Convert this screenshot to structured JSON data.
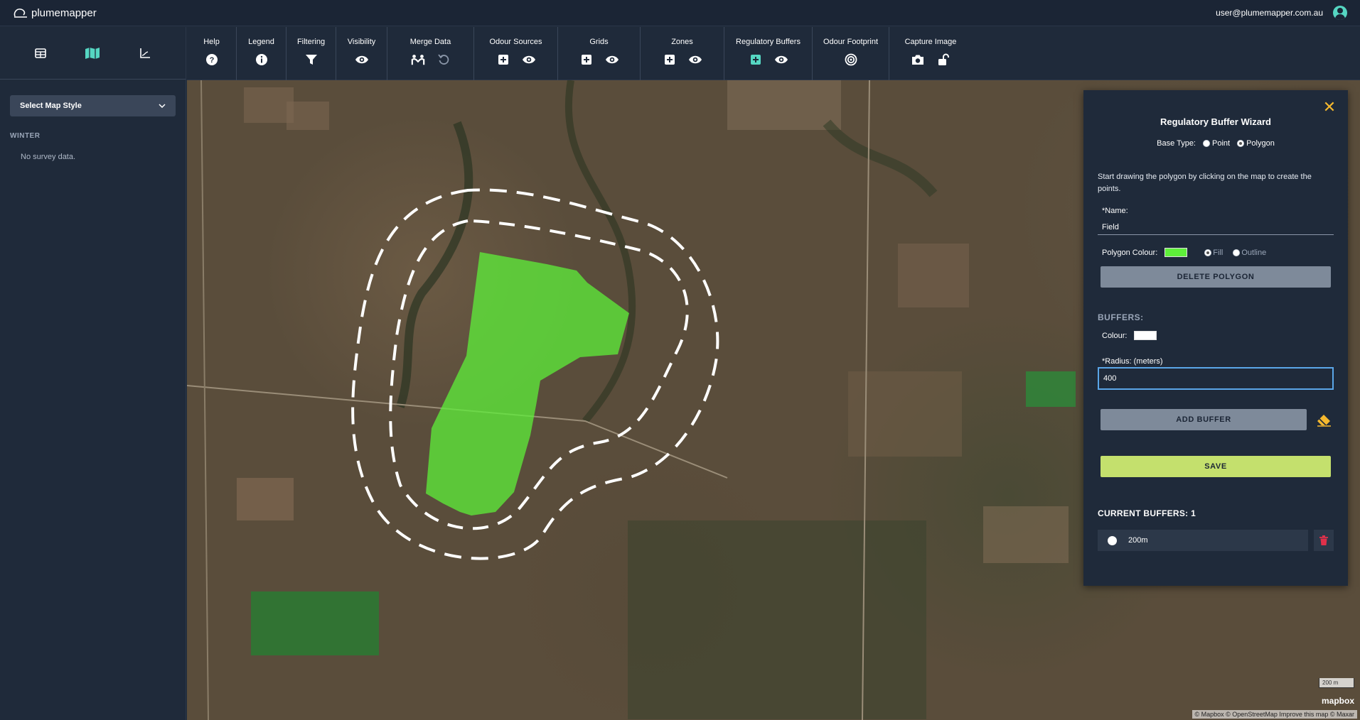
{
  "app": {
    "logo_text": "plumemapper",
    "user_email": "user@plumemapper.com.au"
  },
  "sidebar": {
    "tabs": [
      {
        "name": "table-icon",
        "active": false
      },
      {
        "name": "map-icon",
        "active": true
      },
      {
        "name": "chart-icon",
        "active": false
      }
    ],
    "map_style_label": "Select Map Style",
    "season_label": "WINTER",
    "no_data_text": "No survey data."
  },
  "toolbar": {
    "groups": [
      {
        "label": "Help",
        "icons": [
          "help-icon"
        ]
      },
      {
        "label": "Legend",
        "icons": [
          "info-icon"
        ]
      },
      {
        "label": "Filtering",
        "icons": [
          "filter-icon"
        ]
      },
      {
        "label": "Visibility",
        "icons": [
          "eye-icon"
        ]
      },
      {
        "label": "Merge Data",
        "icons": [
          "merge-icon",
          "undo-icon"
        ]
      },
      {
        "label": "Odour Sources",
        "icons": [
          "add-icon",
          "eye-icon"
        ]
      },
      {
        "label": "Grids",
        "icons": [
          "add-icon",
          "eye-icon"
        ]
      },
      {
        "label": "Zones",
        "icons": [
          "add-icon",
          "eye-icon"
        ]
      },
      {
        "label": "Regulatory Buffers",
        "icons": [
          "add-icon",
          "eye-icon"
        ]
      },
      {
        "label": "Odour Footprint",
        "icons": [
          "target-icon"
        ]
      },
      {
        "label": "Capture Image",
        "icons": [
          "camera-icon",
          "unlock-icon"
        ]
      }
    ]
  },
  "map": {
    "attribution": "© Mapbox © OpenStreetMap Improve this map © Maxar",
    "mapbox_label": "mapbox",
    "scale_label": "200 m"
  },
  "wizard": {
    "title": "Regulatory Buffer Wizard",
    "base_type_label": "Base Type:",
    "base_type_options": [
      "Point",
      "Polygon"
    ],
    "base_type_selected": "Polygon",
    "instructions": "Start drawing the polygon by clicking on the map to create the points.",
    "name_label": "*Name:",
    "name_value": "Field",
    "polygon_colour_label": "Polygon Colour:",
    "polygon_colour": "#5ef03a",
    "fill_label": "Fill",
    "outline_label": "Outline",
    "fill_mode": "Fill",
    "delete_polygon_label": "DELETE POLYGON",
    "buffers_heading": "BUFFERS:",
    "colour_label": "Colour:",
    "buffer_colour": "#ffffff",
    "radius_label": "*Radius: (meters)",
    "radius_value": "400",
    "add_buffer_label": "ADD BUFFER",
    "save_label": "SAVE",
    "current_buffers_label": "CURRENT BUFFERS: 1",
    "current_buffers": [
      {
        "label": "200m",
        "colour": "#ffffff"
      }
    ]
  },
  "colors": {
    "accent_green": "#c4e06d",
    "accent_teal": "#55d6c2",
    "close_orange": "#f5b82e",
    "delete_red": "#e0304a"
  }
}
